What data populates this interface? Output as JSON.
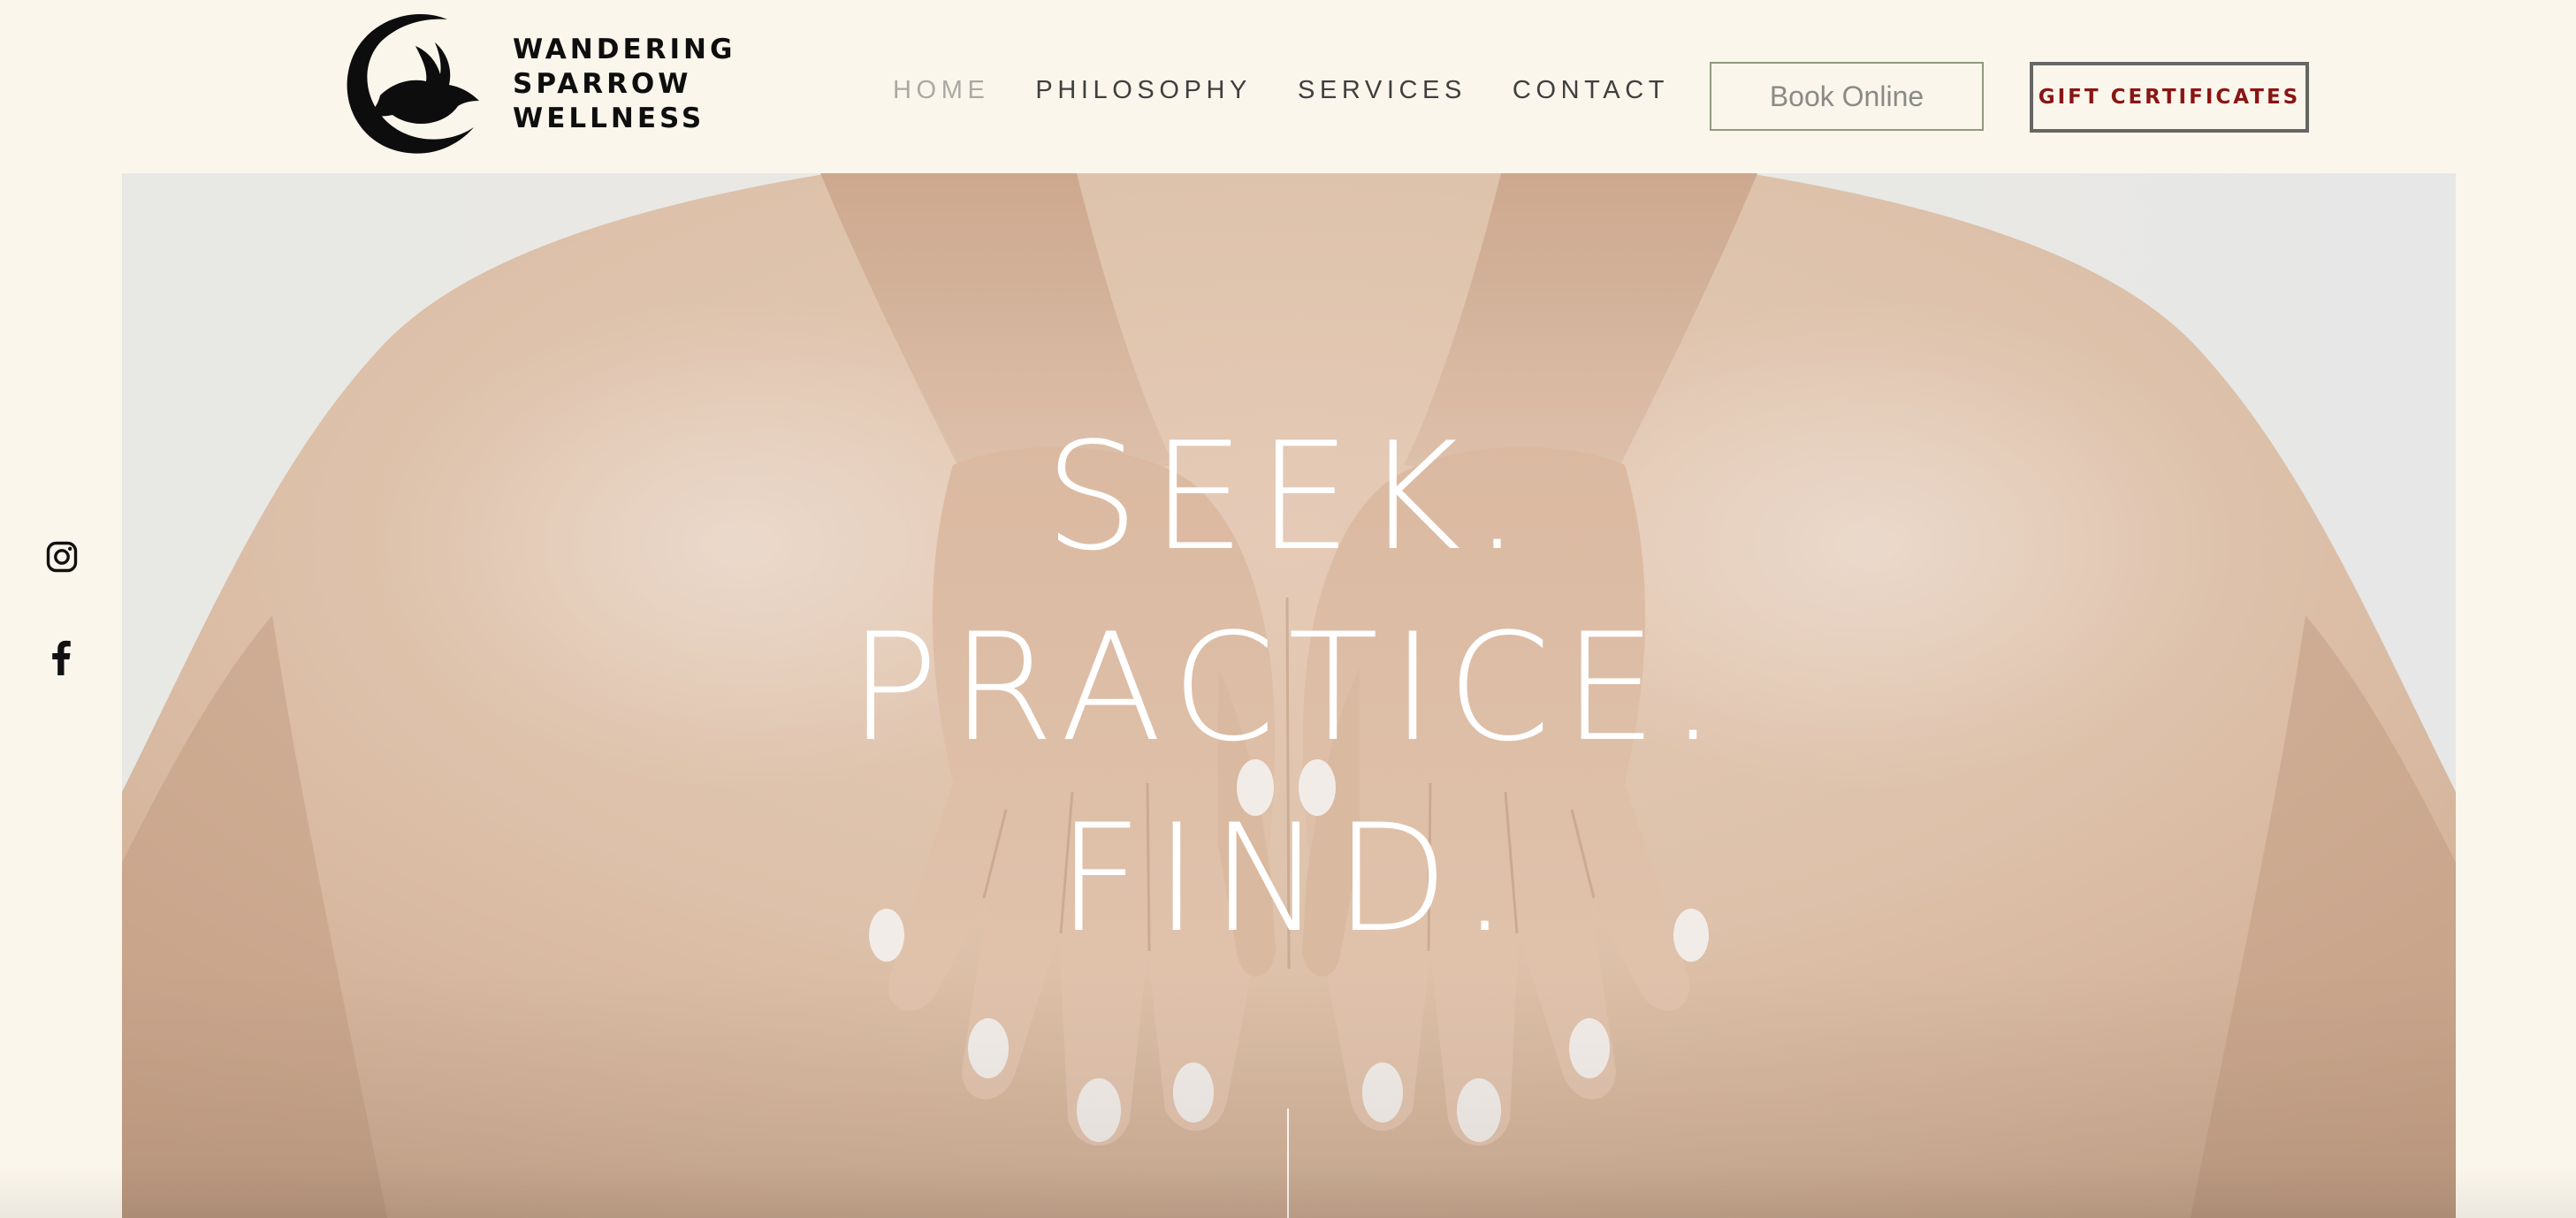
{
  "brand": {
    "name_lines": [
      "WANDERING",
      "SPARROW",
      "WELLNESS"
    ],
    "logo_icon": "sparrow-crescent-icon"
  },
  "nav": {
    "items": [
      {
        "label": "HOME",
        "active": true
      },
      {
        "label": "PHILOSOPHY",
        "active": false
      },
      {
        "label": "SERVICES",
        "active": false
      },
      {
        "label": "CONTACT",
        "active": false
      }
    ]
  },
  "header_buttons": {
    "book_label": "Book Online",
    "gift_label": "GIFT CERTIFICATES"
  },
  "social": [
    {
      "icon": "instagram-icon"
    },
    {
      "icon": "facebook-icon"
    }
  ],
  "hero": {
    "lines": [
      "SEEK.",
      "PRACTICE.",
      "FIND."
    ],
    "image_subject": "hands-on-bare-back-photo"
  },
  "colors": {
    "background": "#fbf6ec",
    "nav_text": "#3f3f3f",
    "nav_active": "#a9a9a3",
    "book_border": "#8f9a7e",
    "gift_text": "#8a1515",
    "gift_border": "#666763",
    "hero_text": "#ffffff"
  }
}
